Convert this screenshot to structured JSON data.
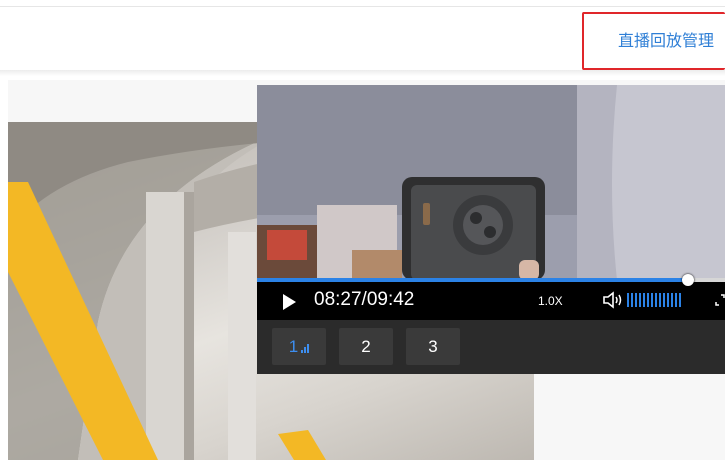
{
  "header": {
    "manage_link_label": "直播回放管理"
  },
  "player": {
    "time_display": "08:27/09:42",
    "speed_label": "1.0X",
    "progress_fraction": 0.92,
    "volume_fraction": 1.0,
    "channels": [
      {
        "label": "1",
        "active": true
      },
      {
        "label": "2",
        "active": false
      },
      {
        "label": "3",
        "active": false
      }
    ]
  },
  "colors": {
    "accent": "#2b82e6",
    "link": "#2f7fd6",
    "highlight_border": "#e0262a",
    "cover_stripe": "#f3b825"
  },
  "icons": {
    "play": "play-icon",
    "volume": "volume-icon",
    "fullscreen": "fullscreen-icon",
    "signal": "signal-bars-icon"
  }
}
